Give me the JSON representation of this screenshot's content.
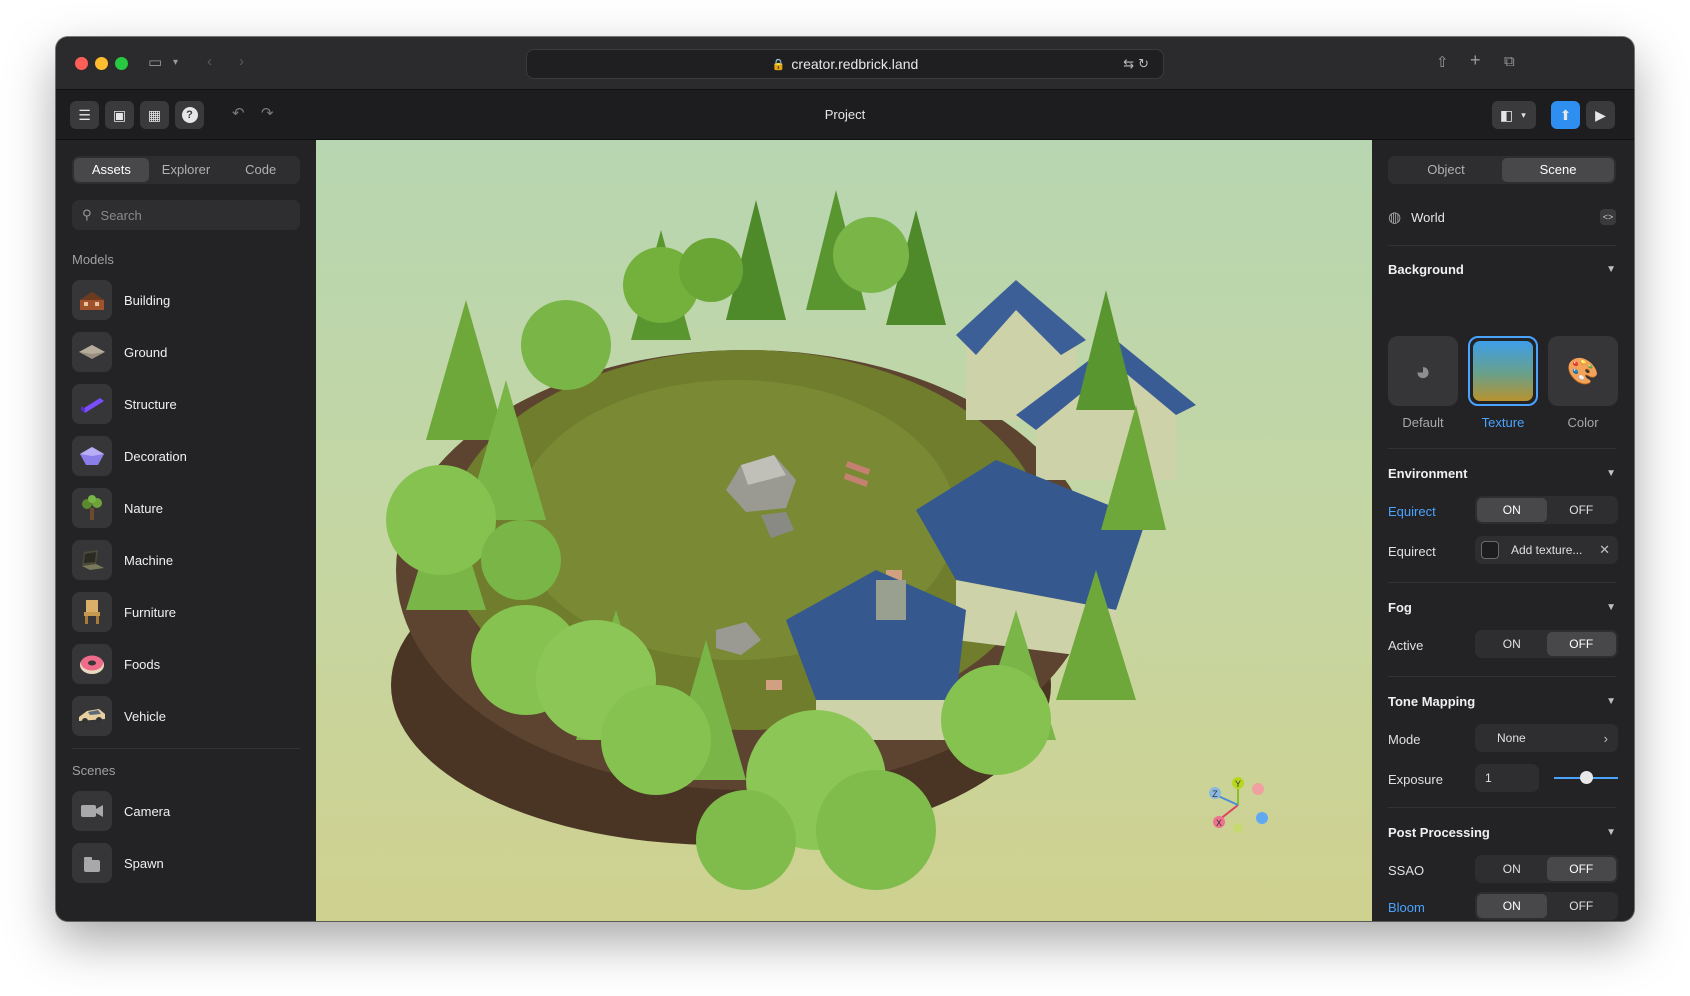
{
  "browser": {
    "url": "creator.redbrick.land"
  },
  "toolbar": {
    "title": "Project"
  },
  "left_panel": {
    "tabs": [
      {
        "label": "Assets",
        "active": true
      },
      {
        "label": "Explorer",
        "active": false
      },
      {
        "label": "Code",
        "active": false
      }
    ],
    "search_placeholder": "Search",
    "models_heading": "Models",
    "models": [
      {
        "label": "Building",
        "icon": "building-icon"
      },
      {
        "label": "Ground",
        "icon": "ground-icon"
      },
      {
        "label": "Structure",
        "icon": "structure-icon"
      },
      {
        "label": "Decoration",
        "icon": "decoration-icon"
      },
      {
        "label": "Nature",
        "icon": "nature-icon"
      },
      {
        "label": "Machine",
        "icon": "machine-icon"
      },
      {
        "label": "Furniture",
        "icon": "furniture-icon"
      },
      {
        "label": "Foods",
        "icon": "foods-icon"
      },
      {
        "label": "Vehicle",
        "icon": "vehicle-icon"
      }
    ],
    "scenes_heading": "Scenes",
    "scenes": [
      {
        "label": "Camera",
        "icon": "camera-icon"
      },
      {
        "label": "Spawn",
        "icon": "spawn-icon"
      }
    ]
  },
  "viewport": {
    "gizmo": {
      "x_label": "X",
      "y_label": "Y",
      "z_label": "Z"
    }
  },
  "right_panel": {
    "tabs": [
      {
        "label": "Object",
        "active": false
      },
      {
        "label": "Scene",
        "active": true
      }
    ],
    "world_label": "World",
    "background": {
      "heading": "Background",
      "options": [
        {
          "label": "Default",
          "selected": false
        },
        {
          "label": "Texture",
          "selected": true
        },
        {
          "label": "Color",
          "selected": false
        }
      ]
    },
    "environment": {
      "heading": "Environment",
      "equirect_toggle_label": "Equirect",
      "on": "ON",
      "off": "OFF",
      "equirect_state": "ON",
      "equirect_texture_label": "Equirect",
      "texture_placeholder": "Add texture..."
    },
    "fog": {
      "heading": "Fog",
      "active_label": "Active",
      "on": "ON",
      "off": "OFF",
      "state": "OFF"
    },
    "tone_mapping": {
      "heading": "Tone Mapping",
      "mode_label": "Mode",
      "mode_value": "None",
      "exposure_label": "Exposure",
      "exposure_value": "1",
      "exposure_slider_fraction": 0.5
    },
    "post_processing": {
      "heading": "Post Processing",
      "ssao_label": "SSAO",
      "bloom_label": "Bloom",
      "on": "ON",
      "off": "OFF",
      "ssao_state": "OFF",
      "bloom_state": "ON"
    }
  },
  "colors": {
    "accent": "#4aa3ff",
    "panel": "#232325",
    "toolbar": "#1d1d1f"
  }
}
